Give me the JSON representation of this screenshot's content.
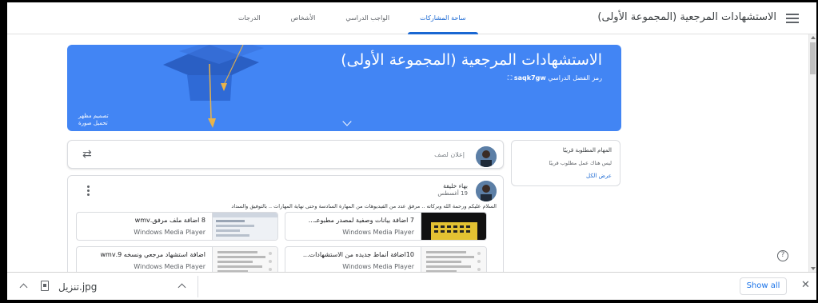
{
  "header": {
    "title": "الاستشهادات المرجعية (المجموعة الأولى)",
    "tabs": [
      {
        "label": "ساحة المشاركات",
        "active": true
      },
      {
        "label": "الواجب الدراسي",
        "active": false
      },
      {
        "label": "الأشخاص",
        "active": false
      },
      {
        "label": "الدرجات",
        "active": false
      }
    ]
  },
  "banner": {
    "title": "الاستشهادات المرجعية (المجموعة الأولى)",
    "class_code_label": "رمز الفصل الدراسي",
    "class_code": "saqk7gw",
    "customize_label": "تصميم مظهر",
    "upload_label": "تحميل صورة",
    "color": "#4285f4"
  },
  "upcoming": {
    "heading": "المهام المطلوبة قريبًا",
    "empty_text": "ليس هناك عمل مطلوب قريبًا",
    "view_all": "عرض الكل"
  },
  "announce": {
    "placeholder": "إعلان لصف"
  },
  "post": {
    "author": "بهاء خليفة",
    "date": "19 أغسطس",
    "body": "السلام عليكم ورحمة الله وبركاته .. مرفق عدد من الفيديوهات من المهارة السادسة وحتى نهاية المهارات .. بالتوفيق والسداد",
    "attachments": [
      {
        "title": "7 اضافة بيانات وصفية لمصدر مطبوعـ...",
        "subtitle": "Windows Media Player"
      },
      {
        "title": "8 اضافة ملف مرفق.wmv",
        "subtitle": "Windows Media Player"
      },
      {
        "title": "10اضافة أنماط جديده من الاستشهادات...",
        "subtitle": "Windows Media Player"
      },
      {
        "title": "اضافة استشهاد مرجعي ونسخه 9.wmv",
        "subtitle": "Windows Media Player"
      }
    ]
  },
  "download_bar": {
    "file_name": "تنزيل.jpg",
    "show_all": "Show all",
    "close": "✕"
  },
  "icons": {
    "menu": "hamburger-menu-icon",
    "repost": "repost-icon",
    "help": "help-icon"
  }
}
